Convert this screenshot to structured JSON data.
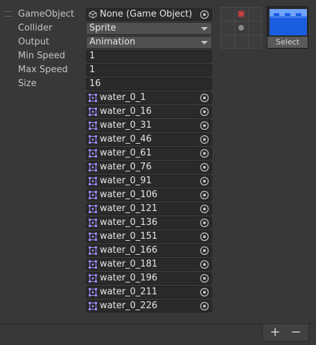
{
  "properties": {
    "gameobject": {
      "label": "GameObject",
      "value": "None (Game Object)"
    },
    "collider": {
      "label": "Collider",
      "value": "Sprite"
    },
    "output": {
      "label": "Output",
      "value": "Animation"
    },
    "min_speed": {
      "label": "Min Speed",
      "value": "1"
    },
    "max_speed": {
      "label": "Max Speed",
      "value": "1"
    },
    "size": {
      "label": "Size",
      "value": "16"
    }
  },
  "sprites": [
    "water_0_1",
    "water_0_16",
    "water_0_31",
    "water_0_46",
    "water_0_61",
    "water_0_76",
    "water_0_91",
    "water_0_106",
    "water_0_121",
    "water_0_136",
    "water_0_151",
    "water_0_166",
    "water_0_181",
    "water_0_196",
    "water_0_211",
    "water_0_226"
  ],
  "preview": {
    "select_label": "Select"
  },
  "footer": {
    "add_label": "+",
    "remove_label": "−"
  },
  "colors": {
    "panel": "#383838",
    "field": "#2a2a2a",
    "water": "#1a5de0",
    "water_top": "#4f8cff",
    "marker": "#e04040"
  },
  "icons": {
    "object_picker": "target-circle-icon",
    "sprite": "sprite-icon",
    "gameobject": "cube-icon"
  }
}
